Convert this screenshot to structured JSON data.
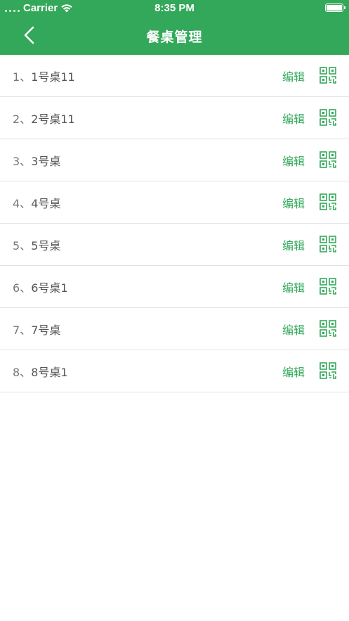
{
  "status_bar": {
    "carrier": "Carrier",
    "time": "8:35 PM"
  },
  "nav": {
    "title": "餐桌管理"
  },
  "tables": [
    {
      "index": "1、",
      "name": "1号桌11",
      "edit_label": "编辑"
    },
    {
      "index": "2、",
      "name": "2号桌11",
      "edit_label": "编辑"
    },
    {
      "index": "3、",
      "name": "3号桌",
      "edit_label": "编辑"
    },
    {
      "index": "4、",
      "name": "4号桌",
      "edit_label": "编辑"
    },
    {
      "index": "5、",
      "name": "5号桌",
      "edit_label": "编辑"
    },
    {
      "index": "6、",
      "name": "6号桌1",
      "edit_label": "编辑"
    },
    {
      "index": "7、",
      "name": "7号桌",
      "edit_label": "编辑"
    },
    {
      "index": "8、",
      "name": "8号桌1",
      "edit_label": "编辑"
    }
  ],
  "icons": {
    "back": "chevron-left-icon",
    "row_action": "qr-code-icon"
  },
  "colors": {
    "brand_green": "#34a85a",
    "text": "#555555",
    "divider": "#e2e2e2"
  }
}
